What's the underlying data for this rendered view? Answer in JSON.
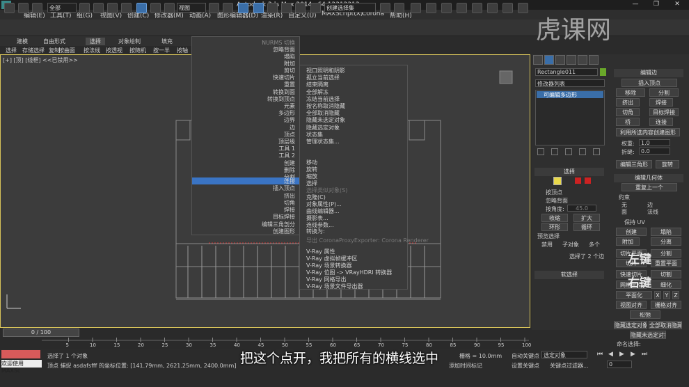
{
  "window": {
    "title": "Autodesk 3ds Max  2014 x64      12312313.max",
    "min": "—",
    "max": "❐",
    "close": "✕"
  },
  "menu": [
    "编辑(E)",
    "工具(T)",
    "组(G)",
    "视图(V)",
    "创建(C)",
    "修改器(M)",
    "动画(A)",
    "图形编辑器(D)",
    "渲染(R)",
    "自定义(U)",
    "MAXScript(X)",
    "Corona",
    "帮助(H)"
  ],
  "toolbar": {
    "selection_filter": "全部",
    "ref_coord": "视图",
    "named_sel": "创建选择集"
  },
  "ribbon": {
    "tabs": [
      "建模",
      "自由形式",
      "选择",
      "对象绘制",
      "填充"
    ],
    "tools": [
      "选择",
      "存储选择",
      "复制",
      "按曲面",
      "按法线",
      "按透视",
      "按随机",
      "按一半",
      "按轴"
    ]
  },
  "viewport": {
    "label": "[+] [顶] [线框] <<已禁用>>",
    "timeline": "0 / 100"
  },
  "quad_left": [
    {
      "label": "NURMS 切换",
      "dim": true
    },
    {
      "label": "忽略背面"
    },
    {
      "label": "塌陷"
    },
    {
      "label": "附加"
    },
    {
      "label": ""
    },
    {
      "label": "剪切"
    },
    {
      "label": "快速切片"
    },
    {
      "label": "重置"
    },
    {
      "label": "转换到面"
    },
    {
      "label": "转换到顶点"
    },
    {
      "label": "元素"
    },
    {
      "label": "多边形"
    },
    {
      "label": "边界"
    },
    {
      "label": "边"
    },
    {
      "label": "顶点"
    },
    {
      "label": "顶层级"
    },
    {
      "label": "工具 1"
    },
    {
      "label": "工具 2"
    },
    {
      "label": "创建"
    },
    {
      "label": "删除"
    },
    {
      "label": "分割"
    },
    {
      "label": "连接"
    },
    {
      "label": "插入顶点"
    },
    {
      "label": "挤出"
    },
    {
      "label": "切角"
    },
    {
      "label": "焊接"
    },
    {
      "label": "目标焊接"
    },
    {
      "label": "编辑三角剖分"
    },
    {
      "label": "创建图形"
    }
  ],
  "quad_right": [
    {
      "label": "视口照明和阴影"
    },
    {
      "label": "孤立当前选择"
    },
    {
      "label": "结束隔离"
    },
    {
      "label": "全部解冻"
    },
    {
      "label": "冻结当前选择"
    },
    {
      "label": "按名称取消隐藏"
    },
    {
      "label": "全部取消隐藏"
    },
    {
      "label": "隐藏未选定对象"
    },
    {
      "label": "隐藏选定对象"
    },
    {
      "label": "状态集"
    },
    {
      "label": "管理状态集..."
    },
    {
      "label": "移动"
    },
    {
      "label": "旋转"
    },
    {
      "label": "缩放"
    },
    {
      "label": "选择"
    },
    {
      "label": "选择类似对象(S)"
    },
    {
      "label": "克隆(C)"
    },
    {
      "label": "对象属性(P)..."
    },
    {
      "label": "曲线编辑器..."
    },
    {
      "label": "摄影表..."
    },
    {
      "label": "连线参数..."
    },
    {
      "label": "转换为:"
    },
    {
      "label": "导出 CoronaProxyExporter: Corona Renderer"
    },
    {
      "label": "V-Ray 属性"
    },
    {
      "label": "V-Ray 虚拟帧缓冲区"
    },
    {
      "label": "V-Ray 场景转换器"
    },
    {
      "label": "V-Ray 位图 -> VRayHDRI 转换器"
    },
    {
      "label": "V-Ray 网格导出"
    },
    {
      "label": "V-Ray 场景文件导出器"
    }
  ],
  "cmd": {
    "object_name": "Rectangle011",
    "modifier_list": "修改器列表",
    "stack_item": "可编辑多边形",
    "edit_edges": "编辑边",
    "insert_vertex": "插入顶点",
    "remove": "移除",
    "split": "分割",
    "extrude": "挤出",
    "weld": "焊接",
    "chamfer": "切角",
    "target_weld": "目标焊接",
    "bridge": "桥",
    "connect": "连接",
    "create_shape": "利用所选内容创建图形",
    "weight_label": "权重:",
    "weight_val": "1.0",
    "crease_label": "折缝:",
    "crease_val": "0.0",
    "edit_tri": "编辑三角形",
    "turn": "旋转",
    "selection": "选择",
    "by_vertex": "按顶点",
    "ignore_back": "忽略背面",
    "by_angle": "按角度:",
    "angle_val": "45.0",
    "shrink": "收缩",
    "grow": "扩大",
    "ring": "环形",
    "loop": "循环",
    "preview_sel": "预览选择",
    "disabled": "禁用",
    "sub_obj": "子对象",
    "multi": "多个",
    "selected_count": "选择了 2 个边",
    "soft_sel": "软选择",
    "edit_geom": "编辑几何体",
    "repeat_last": "重复上一个",
    "constraints": "约束",
    "c_none": "无",
    "c_edge": "边",
    "c_face": "面",
    "c_normal": "法线",
    "keep_uv": "保持 UV",
    "create": "创建",
    "collapse": "塌陷",
    "attach": "附加",
    "detach": "分离",
    "slice_plane": "切片平面",
    "split2": "分割",
    "slice": "切片",
    "reset_plane": "重置平面",
    "quickslice": "快速切片",
    "cut": "切割",
    "meshsmooth": "网格平滑",
    "tessellate": "细化",
    "planarize": "平面化",
    "x": "X",
    "y": "Y",
    "z": "Z",
    "view_align": "视图对齐",
    "grid_align": "栅格对齐",
    "relax": "松弛",
    "hide_sel": "隐藏选定对象",
    "unhide_all": "全部取消隐藏",
    "hide_unsel": "隐藏未选定对象",
    "named_sel": "命名选择:",
    "left_key": "左键",
    "right_key": "右键"
  },
  "status": {
    "welcome": "欢迎使用 MAXSc",
    "selected": "选择了 1 个对象",
    "snap": "顶点 捕捉 asdafsfff 的坐标位置: [141.79mm, 2621.25mm, 2400.0mm]",
    "grid": "栅格 = 10.0mm",
    "auto_key": "自动关键点",
    "set_key": "设置关键点",
    "sel_obj": "选定对象",
    "key_filter": "关键点过滤器...",
    "add_time_tag": "添加时间标记",
    "frame": "0"
  },
  "ticks": [
    "5",
    "10",
    "15",
    "20",
    "25",
    "30",
    "35",
    "40",
    "45",
    "50",
    "55",
    "60",
    "65",
    "70",
    "75",
    "80",
    "85",
    "90",
    "95",
    "100"
  ],
  "subtitle": "把这个点开，我把所有的横线选中",
  "watermark": "虎课网"
}
